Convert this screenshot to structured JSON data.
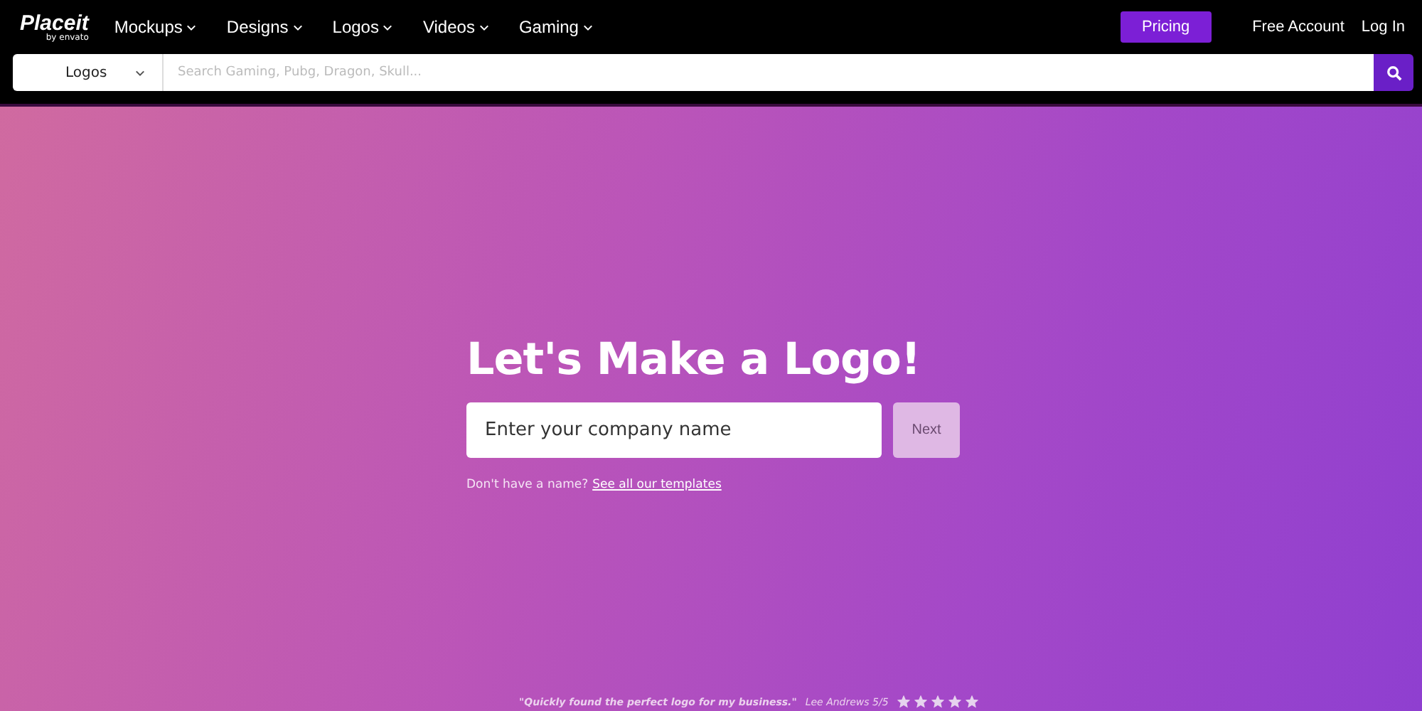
{
  "header": {
    "logo": {
      "name": "Placeit",
      "byline": "by envato"
    },
    "nav": [
      {
        "label": "Mockups",
        "dropdown": true
      },
      {
        "label": "Designs",
        "dropdown": true
      },
      {
        "label": "Logos",
        "dropdown": true
      },
      {
        "label": "Videos",
        "dropdown": true
      },
      {
        "label": "Gaming",
        "dropdown": true
      }
    ],
    "pricing": "Pricing",
    "free_account": "Free Account",
    "login": "Log In"
  },
  "search": {
    "category": "Logos",
    "placeholder": "Search Gaming, Pubg, Dragon, Skull..."
  },
  "hero": {
    "title": "Let's Make a Logo!",
    "input": {
      "placeholder": "Enter your company name"
    },
    "next": "Next",
    "hint": "Don't have a name?",
    "link": "See all our templates"
  },
  "testimonial": {
    "quote": "\"Quickly found the perfect logo for my business.\"",
    "author": "Lee Andrews 5/5",
    "stars": 5
  }
}
